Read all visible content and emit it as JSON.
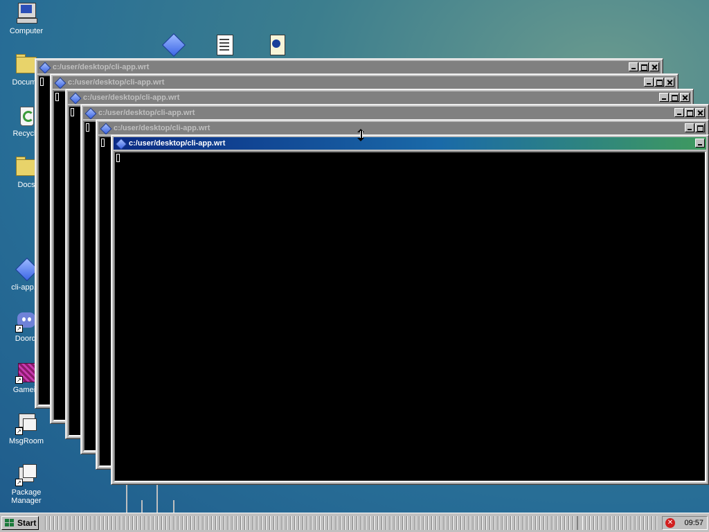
{
  "desktop": {
    "icons": [
      {
        "label": "Computer",
        "icon": "computer-icon"
      },
      {
        "label": "Docume",
        "icon": "folder-icon"
      },
      {
        "label": "Recycle",
        "icon": "recycle-bin-icon"
      },
      {
        "label": "Docs",
        "icon": "folder-icon"
      },
      {
        "label": "cli-app.w",
        "icon": "diamond-app-icon"
      },
      {
        "label": "Doordi",
        "icon": "chat-app-icon"
      },
      {
        "label": "Gamein",
        "icon": "game-cube-icon"
      },
      {
        "label": "MsgRoom",
        "icon": "message-room-icon"
      },
      {
        "label": "Package Manager",
        "icon": "package-manager-icon"
      }
    ],
    "top_icons": [
      "diamond-app-icon",
      "notepad-icon",
      "web-document-icon"
    ]
  },
  "windows": [
    {
      "title": "c:/user/desktop/cli-app.wrt",
      "active": false
    },
    {
      "title": "c:/user/desktop/cli-app.wrt",
      "active": false
    },
    {
      "title": "c:/user/desktop/cli-app.wrt",
      "active": false
    },
    {
      "title": "c:/user/desktop/cli-app.wrt",
      "active": false
    },
    {
      "title": "c:/user/desktop/cli-app.wrt",
      "active": false
    },
    {
      "title": "c:/user/desktop/cli-app.wrt",
      "active": true
    }
  ],
  "taskbar": {
    "start_label": "Start",
    "clock": "09:57",
    "tray_icons": [
      "error-icon"
    ]
  },
  "colors": {
    "active_title_start": "#0a2a84",
    "active_title_end": "#3f9a5e",
    "inactive_title": "#808080",
    "terminal_bg": "#000000",
    "chrome": "#c0c0c0"
  },
  "pointer": "vertical-resize-cursor"
}
